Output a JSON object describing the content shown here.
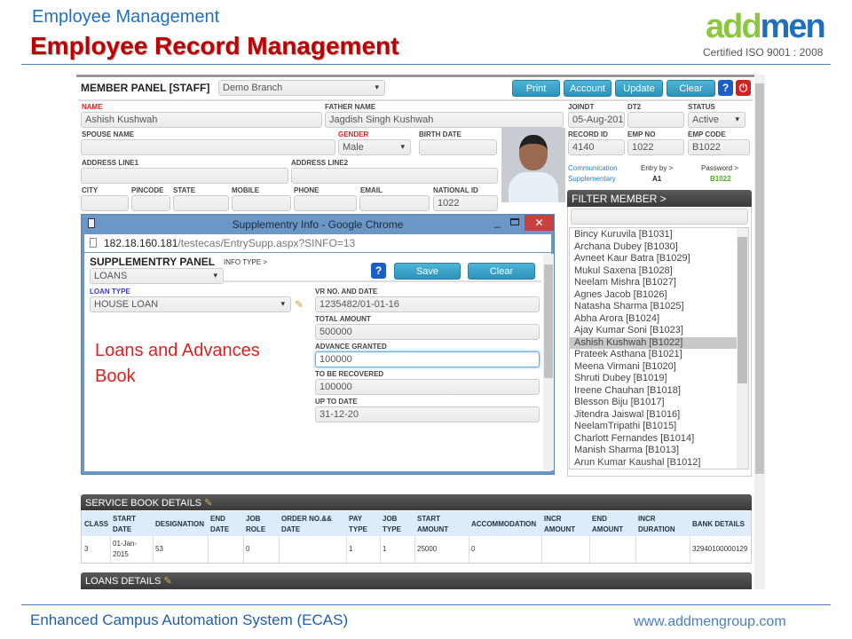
{
  "header": {
    "subtitle": "Employee Management",
    "title": "Employee Record Management",
    "logo_text": "addmen",
    "certified": "Certified ISO 9001 : 2008"
  },
  "member_panel": {
    "title": "MEMBER PANEL [STAFF]",
    "branch": "Demo Branch",
    "buttons": {
      "print": "Print",
      "account": "Account",
      "update": "Update",
      "clear": "Clear",
      "help": "?"
    },
    "fields": {
      "name": {
        "label": "NAME",
        "value": "Ashish Kushwah"
      },
      "father_name": {
        "label": "FATHER NAME",
        "value": "Jagdish Singh Kushwah"
      },
      "joindt": {
        "label": "JOINDT",
        "value": "05-Aug-2015"
      },
      "dt2": {
        "label": "DT2",
        "value": ""
      },
      "status": {
        "label": "STATUS",
        "value": "Active"
      },
      "spouse_name": {
        "label": "SPOUSE NAME",
        "value": ""
      },
      "gender": {
        "label": "GENDER",
        "value": "Male"
      },
      "birth_date": {
        "label": "BIRTH DATE",
        "value": ""
      },
      "record_id": {
        "label": "RECORD ID",
        "value": "4140"
      },
      "emp_no": {
        "label": "EMP NO",
        "value": "1022"
      },
      "emp_code": {
        "label": "EMP CODE",
        "value": "B1022"
      },
      "address1": {
        "label": "ADDRESS LINE1",
        "value": ""
      },
      "address2": {
        "label": "ADDRESS LINE2",
        "value": ""
      },
      "city": {
        "label": "CITY",
        "value": ""
      },
      "pincode": {
        "label": "PINCODE",
        "value": ""
      },
      "state": {
        "label": "STATE",
        "value": ""
      },
      "mobile": {
        "label": "MOBILE",
        "value": ""
      },
      "phone": {
        "label": "PHONE",
        "value": ""
      },
      "email": {
        "label": "EMAIL",
        "value": ""
      },
      "national_id": {
        "label": "NATIONAL ID",
        "value": "1022"
      }
    },
    "links": {
      "communication": "Communication",
      "supplementary": "Supplementary"
    },
    "entry_by_label": "Entry by >",
    "entry_by": "A1",
    "password_label": "Password >",
    "password": "B1022"
  },
  "filter": {
    "title": "FILTER MEMBER >",
    "search": "",
    "selected": "Ashish Kushwah [B1022]",
    "items": [
      "Bincy Kuruvila [B1031]",
      "Archana Dubey [B1030]",
      "Avneet Kaur Batra [B1029]",
      "Mukul Saxena [B1028]",
      "Neelam Mishra [B1027]",
      "Agnes Jacob [B1026]",
      "Natasha Sharma [B1025]",
      "Abha Arora [B1024]",
      "Ajay Kumar Soni [B1023]",
      "Ashish Kushwah [B1022]",
      "Prateek Asthana [B1021]",
      "Meena Virmani [B1020]",
      "Shruti Dubey [B1019]",
      "Ireene Chauhan [B1018]",
      "Blesson Biju [B1017]",
      "Jitendra Jaiswal [B1016]",
      "NeelamTripathi [B1015]",
      "Charlott Fernandes [B1014]",
      "Manish Sharma [B1013]",
      "Arun Kumar Kaushal [B1012]"
    ]
  },
  "popup": {
    "window_title": "Supplementry Info - Google Chrome",
    "url_host": "182.18.160.181",
    "url_path": "/testecas/EntrySupp.aspx?SINFO=13",
    "panel_title": "SUPPLEMENTRY PANEL",
    "info_type_label": "INFO TYPE >",
    "info_type": "LOANS",
    "save": "Save",
    "clear": "Clear",
    "help": "?",
    "loan_type_label": "LOAN TYPE",
    "loan_type": "HOUSE LOAN",
    "vr_label": "VR NO. AND DATE",
    "vr": "1235482/01-01-16",
    "total_label": "TOTAL AMOUNT",
    "total": "500000",
    "advance_label": "ADVANCE GRANTED",
    "advance": "100000",
    "recover_label": "TO BE RECOVERED",
    "recover": "100000",
    "upto_label": "UP TO DATE",
    "upto": "31-12-20"
  },
  "annotation": {
    "line1": "Loans and Advances",
    "line2": "Book"
  },
  "service_book": {
    "title": "SERVICE BOOK DETAILS",
    "columns": [
      [
        "CLASS",
        ""
      ],
      [
        "START",
        "DATE"
      ],
      [
        "DESIGNATION",
        ""
      ],
      [
        "END",
        "DATE"
      ],
      [
        "JOB",
        "ROLE"
      ],
      [
        "ORDER NO.&&",
        "DATE"
      ],
      [
        "PAY",
        "TYPE"
      ],
      [
        "JOB",
        "TYPE"
      ],
      [
        "START",
        "AMOUNT"
      ],
      [
        "ACCOMMODATION",
        ""
      ],
      [
        "INCR",
        "AMOUNT"
      ],
      [
        "END",
        "AMOUNT"
      ],
      [
        "INCR",
        "DURATION"
      ],
      [
        "BANK DETAILS",
        ""
      ]
    ],
    "rows": [
      [
        [
          "3",
          ""
        ],
        [
          "01-Jan-",
          "2015"
        ],
        [
          "53",
          ""
        ],
        [
          "",
          ""
        ],
        [
          "0",
          ""
        ],
        [
          "",
          ""
        ],
        [
          "1",
          ""
        ],
        [
          "1",
          ""
        ],
        [
          "25000",
          ""
        ],
        [
          "0",
          ""
        ],
        [
          "",
          ""
        ],
        [
          "",
          ""
        ],
        [
          "",
          ""
        ],
        [
          "32940100000129",
          ""
        ]
      ]
    ]
  },
  "loans_details": {
    "title": "LOANS DETAILS"
  },
  "footer": {
    "left": "Enhanced Campus Automation System (ECAS)",
    "right": "www.addmengroup.com"
  },
  "colors": {
    "accent_blue": "#2b92b8",
    "title_red": "#c00000",
    "header_blue": "#1f6fbf"
  }
}
